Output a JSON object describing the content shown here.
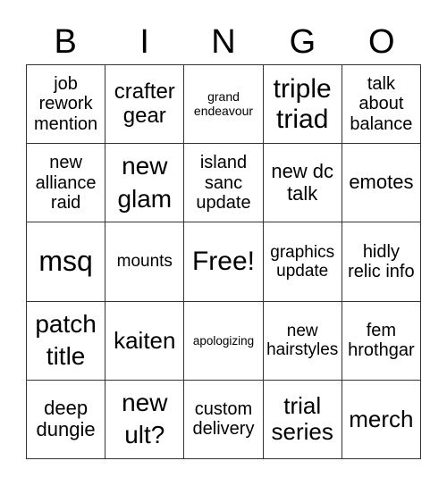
{
  "header": [
    "B",
    "I",
    "N",
    "G",
    "O"
  ],
  "cells": [
    [
      "job rework mention",
      "crafter gear",
      "grand endeavour",
      "triple triad",
      "talk about balance"
    ],
    [
      "new alliance raid",
      "new glam",
      "island sanc update",
      "new dc talk",
      "emotes"
    ],
    [
      "msq",
      "mounts",
      "Free!",
      "graphics update",
      "hidly relic info"
    ],
    [
      "patch title",
      "kaiten",
      "apologizing",
      "new hairstyles",
      "fem hrothgar"
    ],
    [
      "deep dungie",
      "new ult?",
      "custom delivery",
      "trial series",
      "merch"
    ]
  ]
}
